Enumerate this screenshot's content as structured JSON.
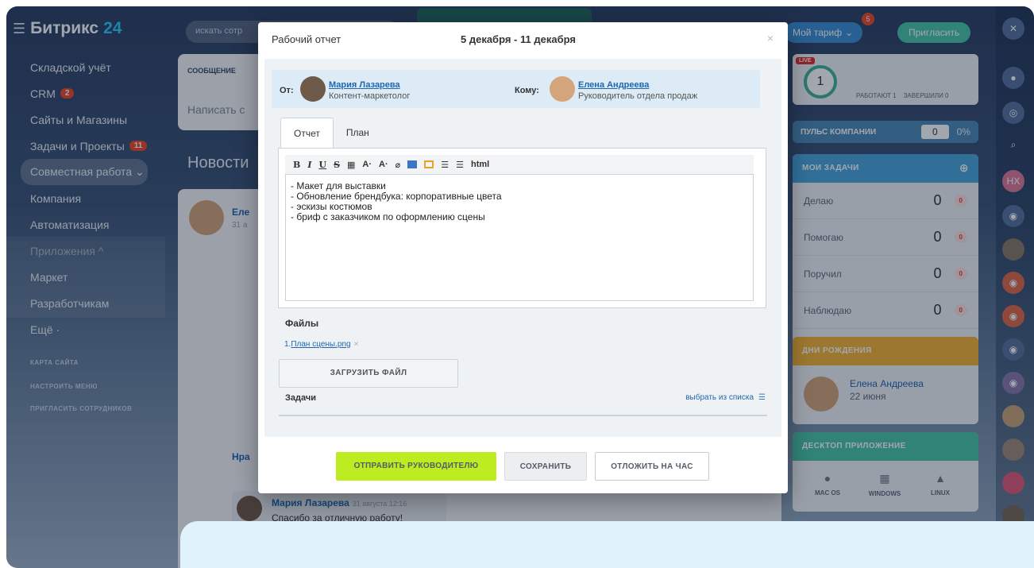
{
  "sidebar": {
    "logo_text": "Битрикс",
    "logo_num": "24",
    "items": [
      {
        "label": "Складской учёт"
      },
      {
        "label": "CRM",
        "counter": "2"
      },
      {
        "label": "Сайты и Магазины"
      },
      {
        "label": "Задачи и Проекты",
        "counter": "11"
      },
      {
        "label": "Совместная работа ⌄"
      },
      {
        "label": "Компания"
      },
      {
        "label": "Автоматизация"
      },
      {
        "label": "Приложения ^"
      },
      {
        "label": "Маркет"
      },
      {
        "label": "Разработчикам"
      },
      {
        "label": "Ещё ·"
      }
    ],
    "small_links": [
      "КАРТА САЙТА",
      "НАСТРОИТЬ МЕНЮ",
      "ПРИГЛАСИТЬ СОТРУДНИКОВ"
    ]
  },
  "header": {
    "search_placeholder": "искать сотр",
    "tariff_label": "Мой тариф",
    "tariff_badge": "5",
    "invite_label": "Пригласить"
  },
  "feed": {
    "tab_label": "СООБЩЕНИЕ",
    "write_placeholder": "Написать с",
    "news_title": "Новости",
    "post_author": "Еле",
    "post_date": "31 а",
    "like_label": "Нра",
    "comment": {
      "author": "Мария Лазарева",
      "time": "31 августа 12:16",
      "text": "Спасибо за отличную работу!"
    }
  },
  "right": {
    "live_tag": "LIVE",
    "live_count": "1",
    "working": "РАБОТАЮТ 1",
    "finished": "ЗАВЕРШИЛИ 0",
    "pulse_label": "ПУЛЬС КОМПАНИИ",
    "pulse_value": "0",
    "pulse_pct": "0%",
    "tasks_title": "МОИ ЗАДАЧИ",
    "task_rows": [
      {
        "label": "Делаю",
        "count": "0",
        "badge": "0"
      },
      {
        "label": "Помогаю",
        "count": "0",
        "badge": "0"
      },
      {
        "label": "Поручил",
        "count": "0",
        "badge": "0"
      },
      {
        "label": "Наблюдаю",
        "count": "0",
        "badge": "0"
      }
    ],
    "birthday_title": "ДНИ РОЖДЕНИЯ",
    "birthday_name": "Елена Андреева",
    "birthday_date": "22 июня",
    "desktop_title": "ДЕСКТОП ПРИЛОЖЕНИЕ",
    "os": [
      "MAC OS",
      "WINDOWS",
      "LINUX"
    ]
  },
  "modal": {
    "title": "Рабочий отчет",
    "period": "5 декабря - 11 декабря",
    "close": "×",
    "from_label": "От:",
    "from_name": "Мария Лазарева",
    "from_role": "Контент-маркетолог",
    "to_label": "Кому:",
    "to_name": "Елена Андреева",
    "to_role": "Руководитель отдела продаж",
    "tabs": [
      "Отчет",
      "План"
    ],
    "toolbar": [
      "B",
      "I",
      "U",
      "S",
      "html"
    ],
    "report_lines": [
      "- Макет для выставки",
      "- Обновление брендбука: корпоративные цвета",
      "- эскизы костюмов",
      "- бриф с заказчиком по оформлению сцены"
    ],
    "files_title": "Файлы",
    "file_index": "1.",
    "file_name": "План сцены.png",
    "upload_label": "ЗАГРУЗИТЬ ФАЙЛ",
    "tasks_title": "Задачи",
    "tasks_pick": "выбрать из списка",
    "send_label": "ОТПРАВИТЬ РУКОВОДИТЕЛЮ",
    "save_label": "СОХРАНИТЬ",
    "later_label": "ОТЛОЖИТЬ НА ЧАС"
  },
  "colors": {
    "accent_green": "#bbed21",
    "link_blue": "#2067b0",
    "badge_red": "#f0482b"
  }
}
